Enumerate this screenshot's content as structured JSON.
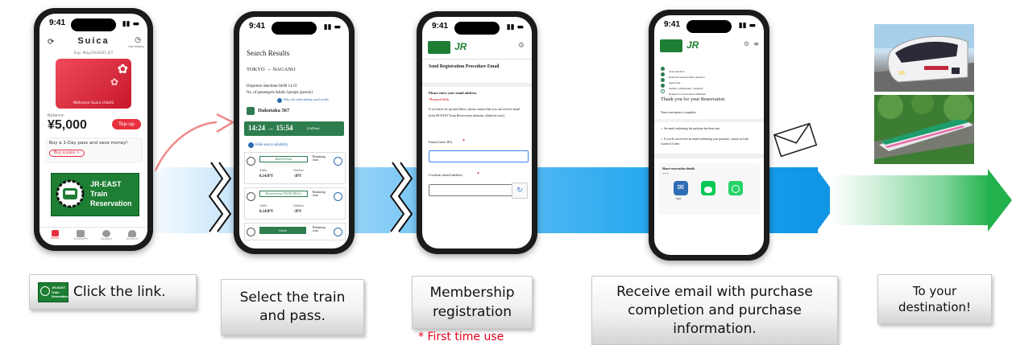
{
  "status_time": "9:41",
  "phone1": {
    "app_title": "Suica",
    "menu_sub": "Use history",
    "exp_line": "Exp. May/2026/05 JST",
    "card_caption": "Welcome Suica chiikiS",
    "balance_label": "Balance",
    "balance": "¥5,000",
    "topup": "Top-up",
    "promo_text": "Buy a 1-Day pass and save money!",
    "promo_btn": "Buy a pass >",
    "banner_lines": [
      "JR-EAST",
      "Train",
      "Reservation"
    ],
    "tabs": [
      "Home",
      "Tickets/Ps",
      "Support",
      "Account"
    ]
  },
  "phone2": {
    "heading": "Search Results",
    "route": "TOKYO → NAGANO",
    "departure": "Departure date/time 04/08 14:10",
    "passengers": "No. of passengers:Adults 1people (person)",
    "help_link": "Help with understanding search results",
    "train_name": "Hakutaka 567",
    "time_range": "14:24 → 15:54",
    "duration": "(1h30m)",
    "hide_seat": "Hide seat availability",
    "rows": [
      {
        "seat": "Reserved seat",
        "remain": "Remaining seats",
        "adult_label": "Adults",
        "adult": "8,14JPY",
        "child_label": "Children",
        "child": "-JPY"
      },
      {
        "seat": "Reserved seat (TRAIN DEAL)",
        "remain": "Remaining seats",
        "adult_label": "Adults",
        "adult": "8,14JPY",
        "child_label": "Children",
        "child": "-JPY"
      },
      {
        "seat": "Green",
        "remain": "Remaining seats"
      }
    ]
  },
  "phone3": {
    "heading": "Send Registration Procedure Email",
    "prompt": "Please enter your email address.",
    "required": "*Required fields",
    "body": "If you have set up mail filters, please ensure that you can receive email from JR-EAST Train Reservation (domain: @jrkeset.com).",
    "email_label": "Email (user ID)",
    "confirm_label": "Confirm email address"
  },
  "phone4": {
    "steps": [
      "Your selection",
      "Reserved seat purchase selection",
      "Agree seat",
      "Details confirmation / payment",
      "Request for reservation submitted"
    ],
    "thanks": "Thank you for your Reservation",
    "complete": "Your reservation is complete.",
    "check1": "An email confirming the purchase has been sent",
    "check2": "If you do not receive an email confirming your purchase, contact us from Contact Us here.",
    "share_title": "Share reservation details",
    "share_sub": "※※※",
    "share_items": [
      "Mail",
      "LINE",
      "WhatsApp"
    ]
  },
  "captions": {
    "c1": "Click the link.",
    "c1_tile": [
      "JR-EAST",
      "Train",
      "Reservation"
    ],
    "c2": "Select the train and pass.",
    "c3": "Membership registration",
    "c3_note": "* First time use",
    "c4": "Receive email with purchase completion and purchase information.",
    "c5": "To your destination!"
  },
  "colors": {
    "accent_green": "#2e7d4f",
    "suica_red": "#e8303f",
    "note_red": "#e5001b",
    "flow_blue": "#1196e6",
    "flow_green": "#22b14c"
  }
}
